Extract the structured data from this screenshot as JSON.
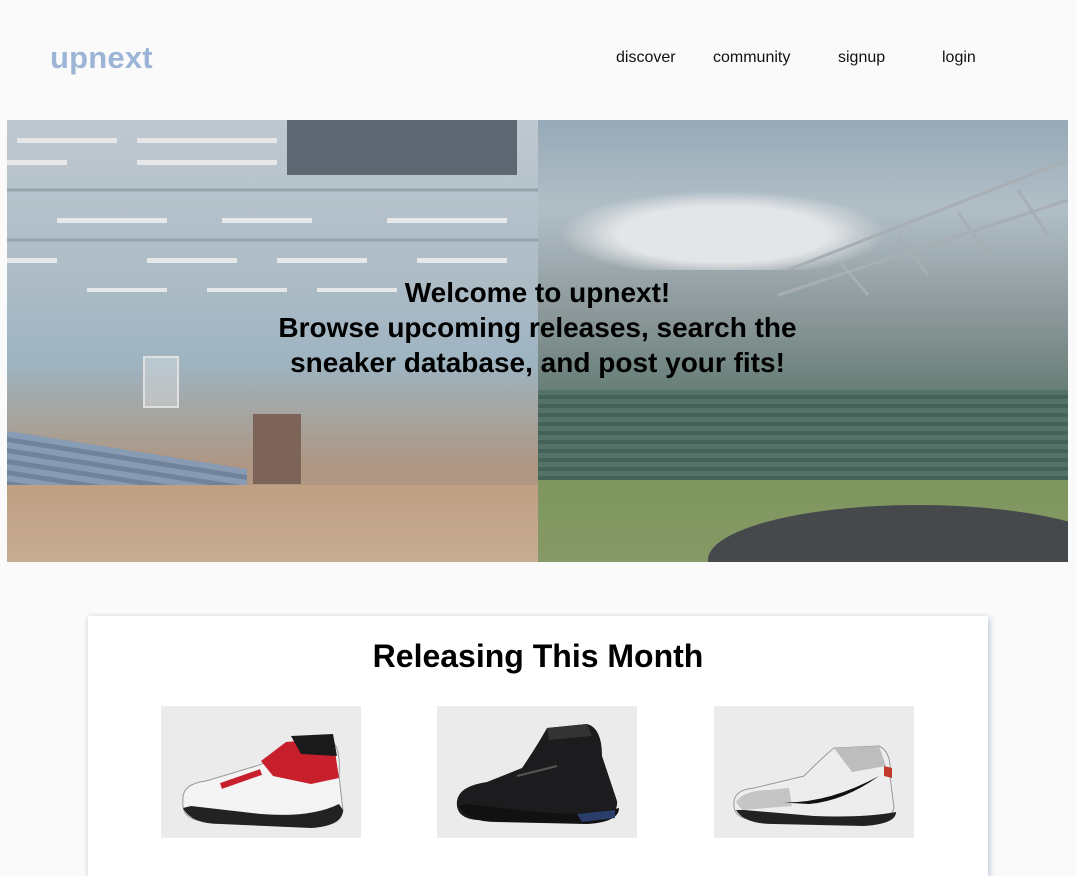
{
  "header": {
    "logo": "upnext",
    "nav": [
      "discover",
      "community",
      "signup",
      "login"
    ]
  },
  "hero": {
    "line1": "Welcome to upnext!",
    "line2": "Browse upcoming releases, search the",
    "line3": "sneaker database, and post your fits!"
  },
  "releases": {
    "title": "Releasing This Month",
    "items": [
      {
        "colorway": "red-white-black"
      },
      {
        "colorway": "all-black"
      },
      {
        "colorway": "grey-white-black"
      }
    ]
  },
  "colors": {
    "logo": "#9cb5d6",
    "background": "#fafafa",
    "card": "#ffffff"
  }
}
